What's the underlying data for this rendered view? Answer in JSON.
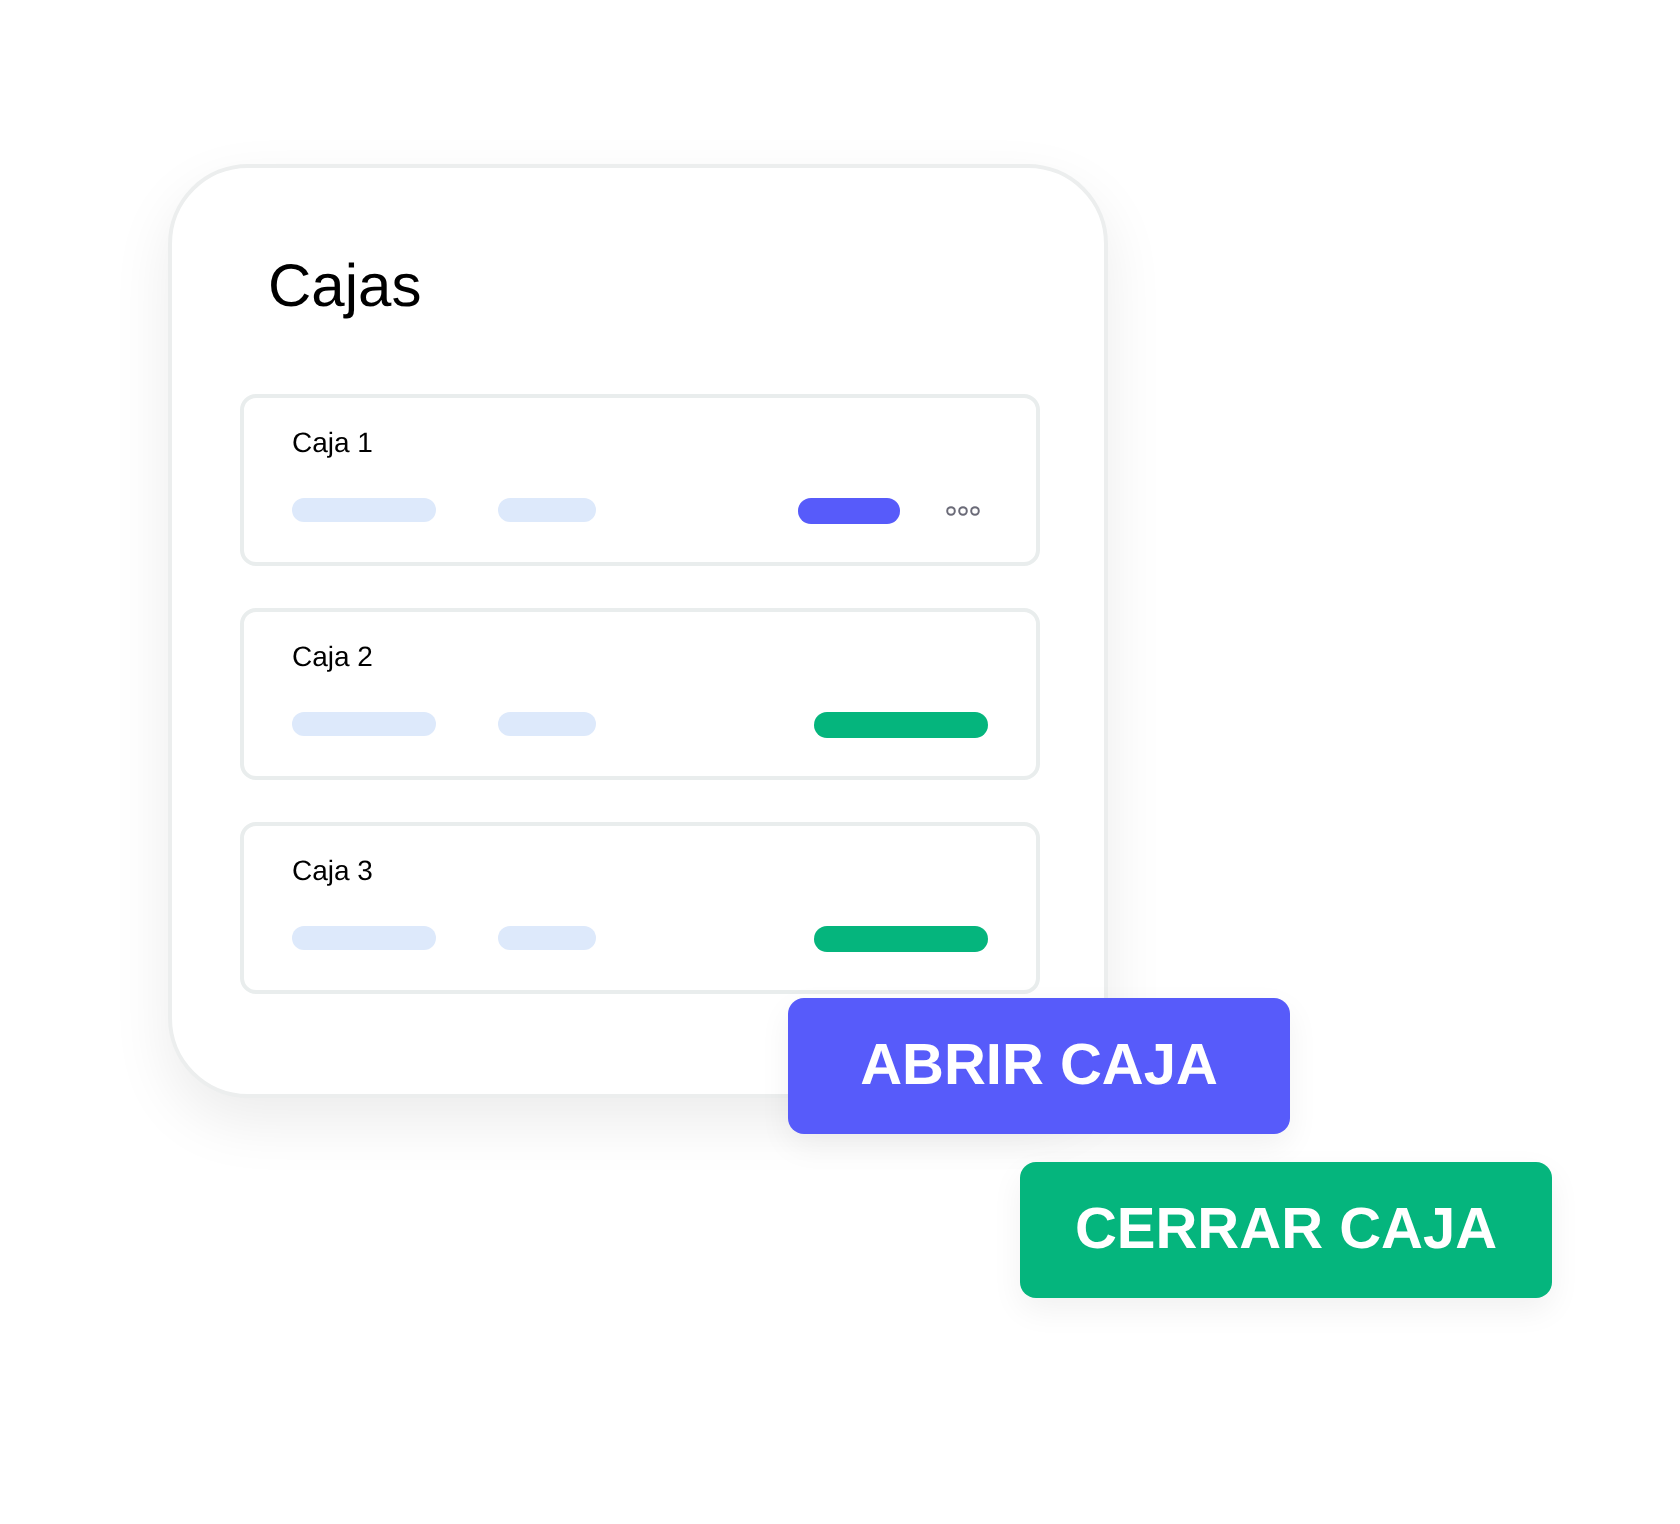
{
  "panel": {
    "title": "Cajas",
    "rows": [
      {
        "label": "Caja 1",
        "color": "#575bfa",
        "has_menu": true
      },
      {
        "label": "Caja 2",
        "color": "#05b57d",
        "has_menu": false
      },
      {
        "label": "Caja 3",
        "color": "#05b57d",
        "has_menu": false
      }
    ]
  },
  "buttons": [
    {
      "label": "ABRIR CAJA",
      "color": "#575bfa"
    },
    {
      "label": "CERRAR CAJA",
      "color": "#05b57d"
    }
  ]
}
